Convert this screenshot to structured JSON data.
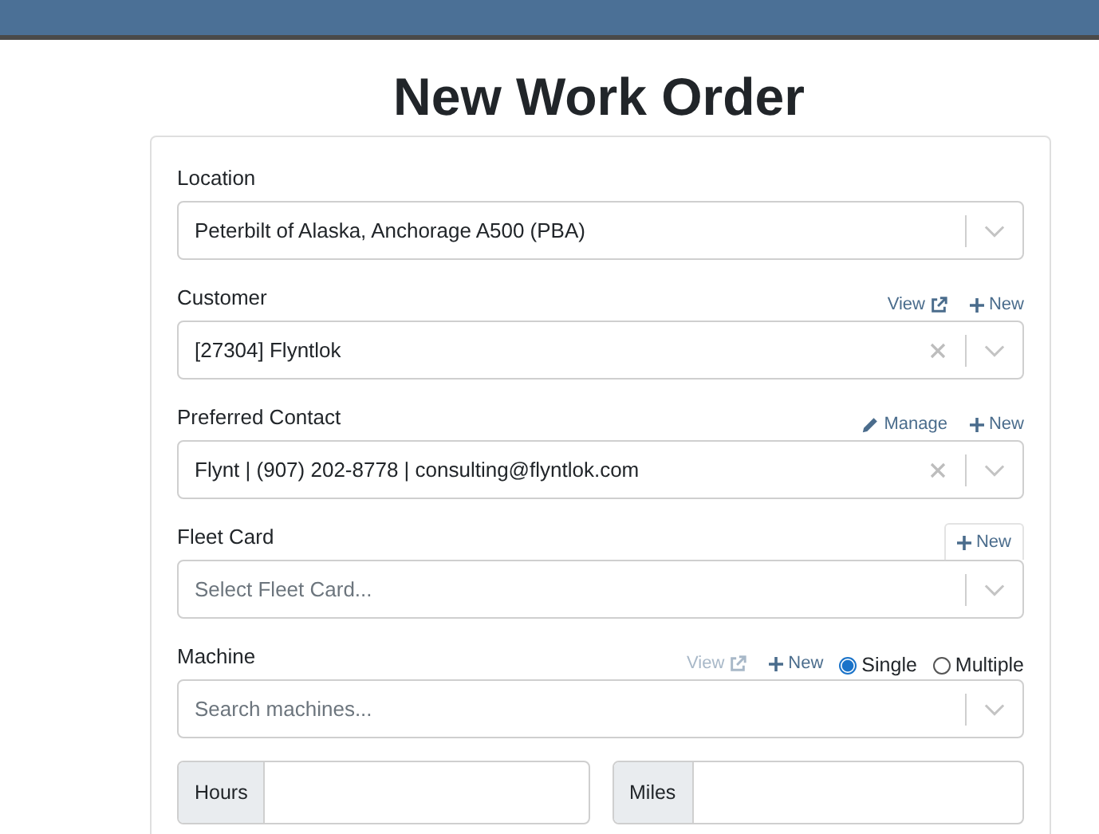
{
  "title": "New Work Order",
  "fields": [
    {
      "label": "Location",
      "value": "Peterbilt of Alaska, Anchorage A500 (PBA)",
      "clearable": false
    },
    {
      "label": "Customer",
      "value": "[27304] Flyntlok",
      "clearable": true,
      "actions": [
        {
          "kind": "view",
          "label": "View",
          "disabled": false
        },
        {
          "kind": "new",
          "label": "New"
        }
      ]
    },
    {
      "label": "Preferred Contact",
      "value": "Flynt | (907) 202-8778 | consulting@flyntlok.com",
      "clearable": true,
      "actions": [
        {
          "kind": "manage",
          "label": "Manage"
        },
        {
          "kind": "new",
          "label": "New"
        }
      ]
    },
    {
      "label": "Fleet Card",
      "placeholder": "Select Fleet Card...",
      "clearable": false,
      "actions": [
        {
          "kind": "new-button",
          "label": "New"
        }
      ]
    },
    {
      "label": "Machine",
      "placeholder": "Search machines...",
      "clearable": false,
      "actions": [
        {
          "kind": "view",
          "label": "View",
          "disabled": true
        },
        {
          "kind": "new",
          "label": "New"
        }
      ],
      "radios": [
        {
          "label": "Single",
          "selected": true
        },
        {
          "label": "Multiple",
          "selected": false
        }
      ]
    }
  ],
  "inputs": [
    {
      "addon": "Hours"
    },
    {
      "addon": "Miles"
    }
  ]
}
